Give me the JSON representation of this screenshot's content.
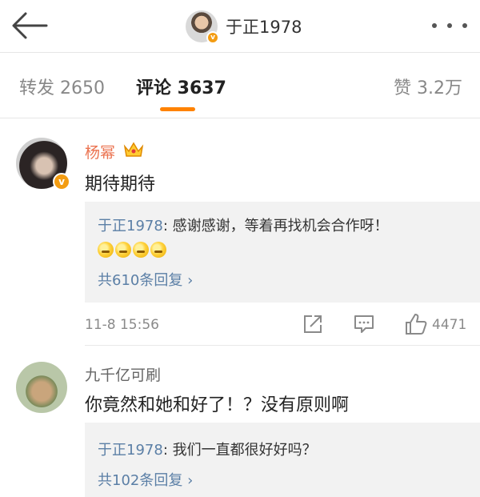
{
  "header": {
    "title": "于正1978",
    "avatar_badge": "v"
  },
  "tabs": {
    "repost": "转发 2650",
    "comment": "评论 3637",
    "like": "赞 3.2万",
    "accent_color": "#ff8200"
  },
  "comments": [
    {
      "author": "杨幂",
      "author_color": "#eb7350",
      "badge": "v",
      "text": "期待期待",
      "reply": {
        "user": "于正1978",
        "text": ": 感谢感谢，等着再找机会合作呀！",
        "emoji_count": 4,
        "count_label": "共610条回复 ›"
      },
      "time": "11-8 15:56",
      "likes": "4471"
    },
    {
      "author": "九千亿可刷",
      "author_color": "#666666",
      "text": "你竟然和她和好了！？没有原则啊",
      "reply": {
        "user": "于正1978",
        "text": ": 我们一直都很好好吗？",
        "count_label": "共102条回复 ›"
      }
    }
  ]
}
